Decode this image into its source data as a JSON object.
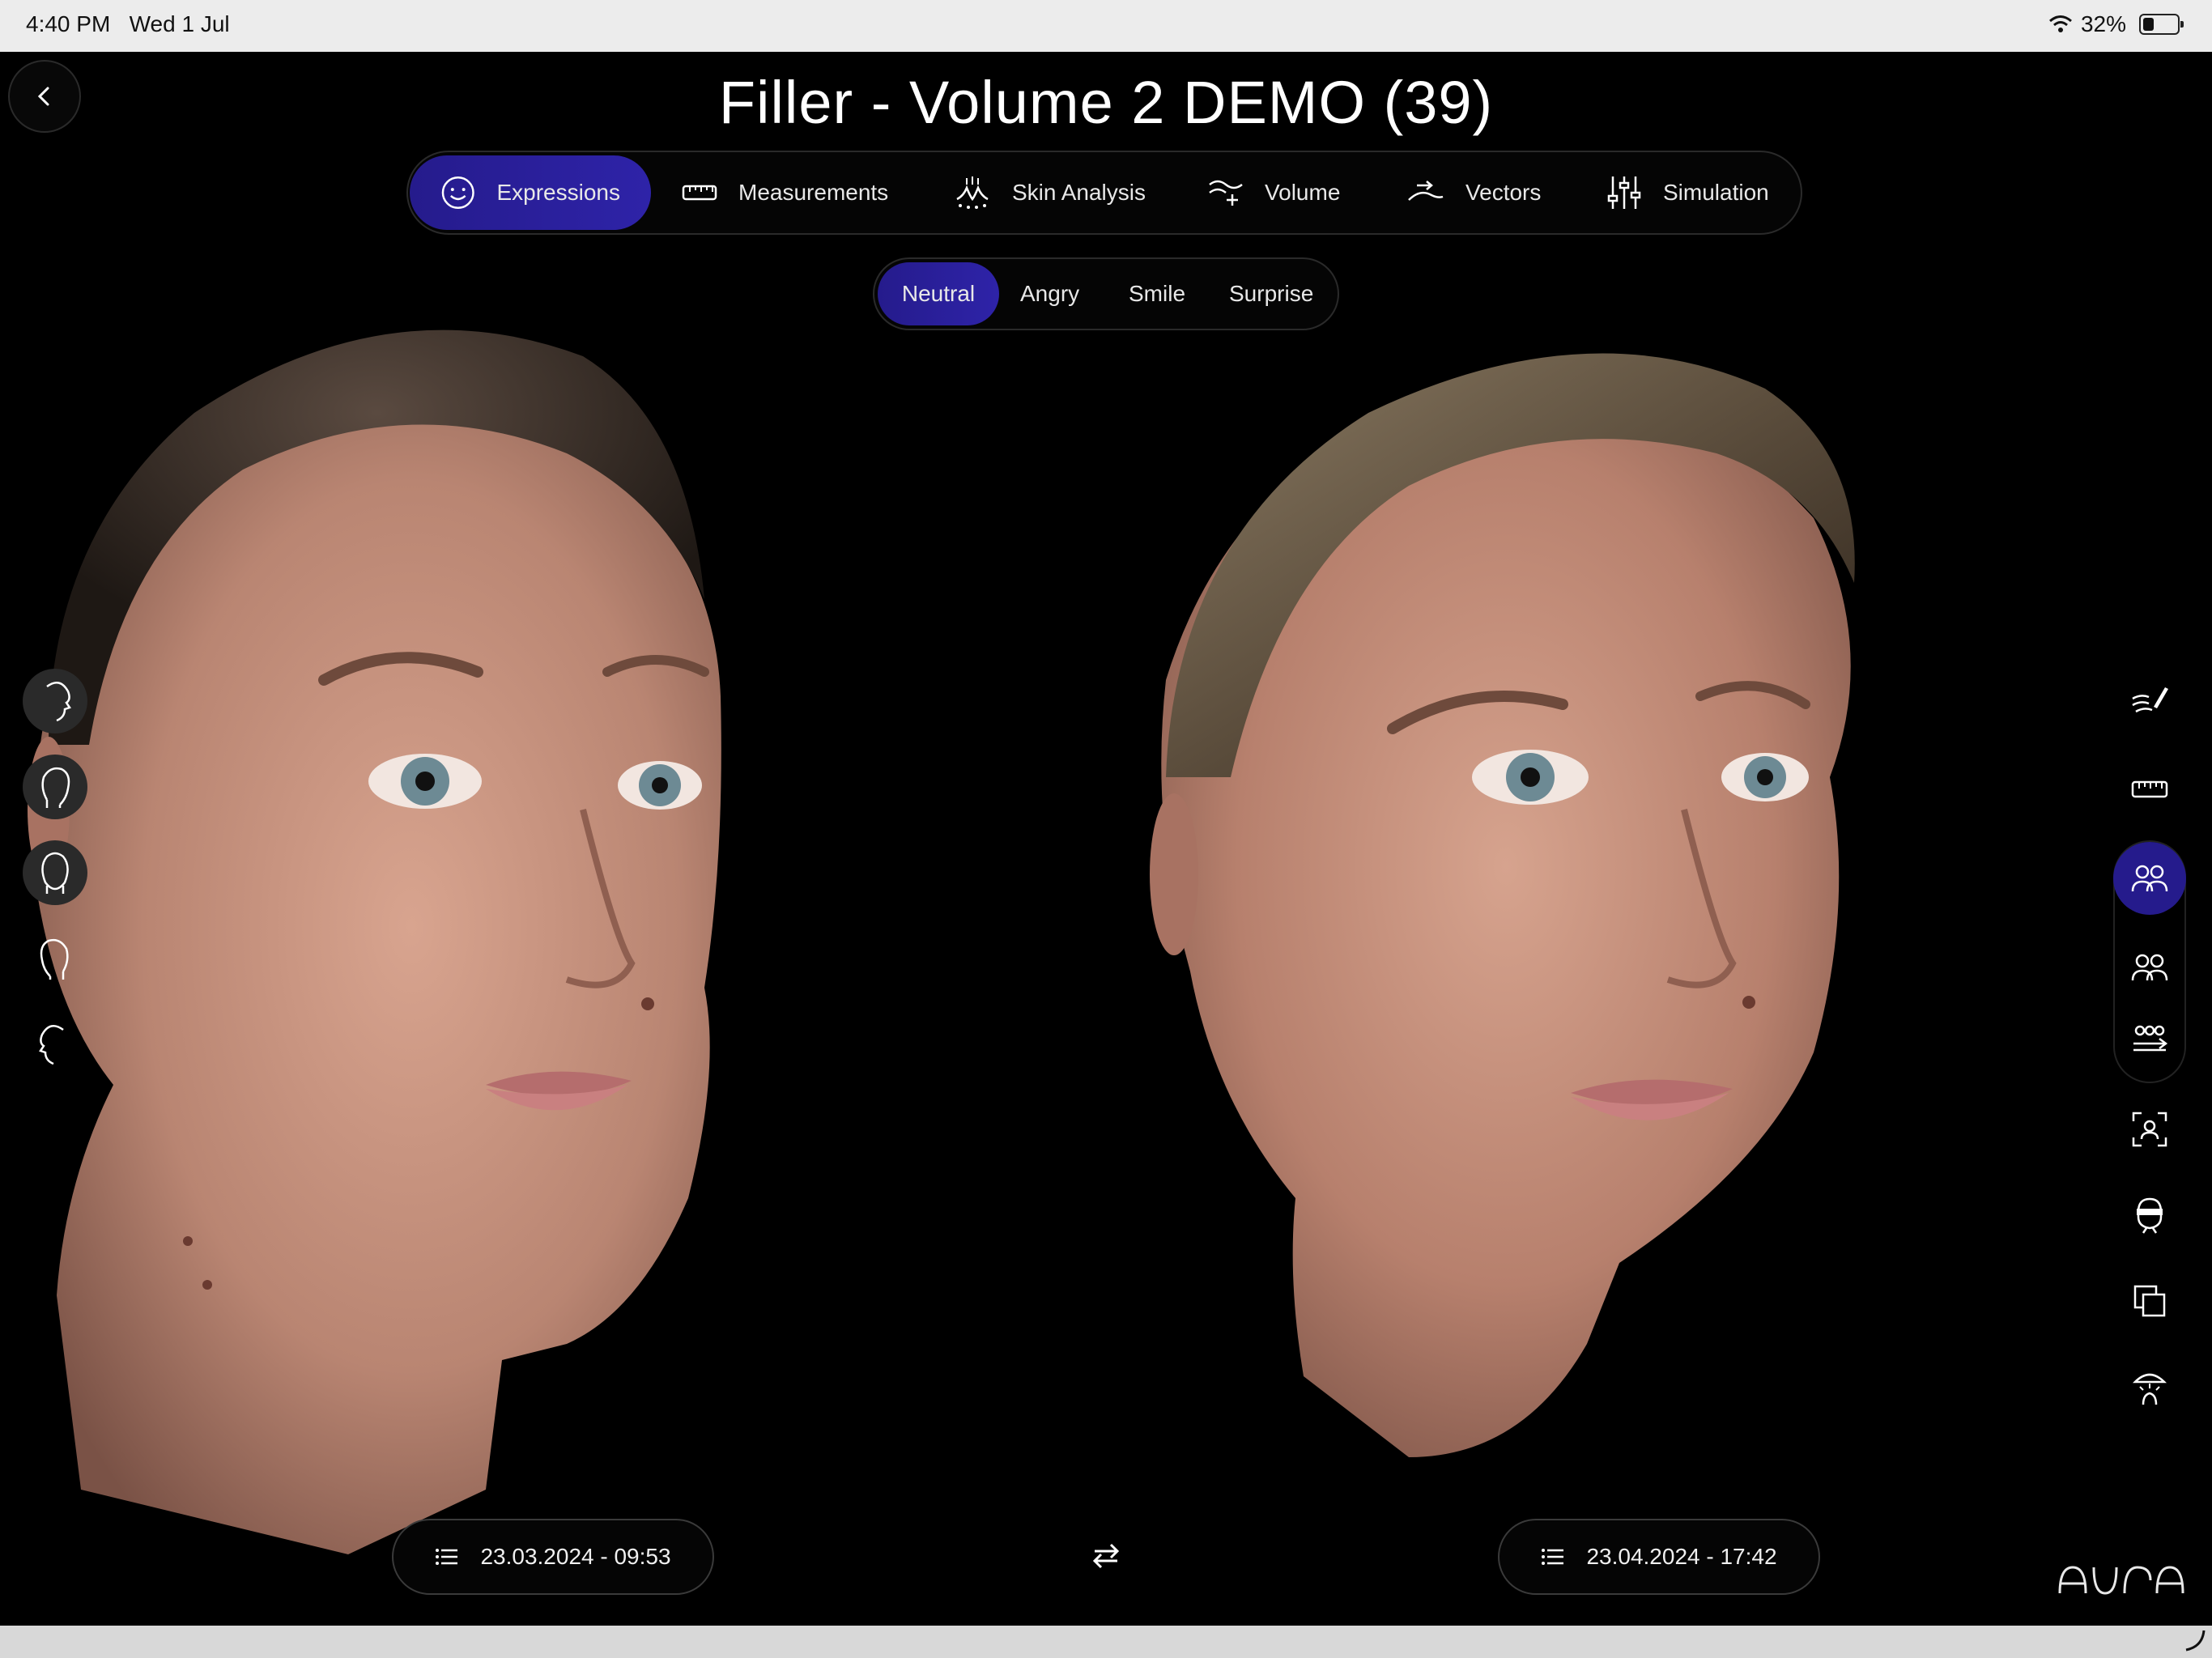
{
  "status_bar": {
    "time": "4:40 PM",
    "date": "Wed 1 Jul",
    "battery": "32%",
    "battery_level": 0.32
  },
  "header": {
    "title": "Filler - Volume 2 DEMO (39)"
  },
  "tabs": [
    {
      "label": "Expressions",
      "icon": "smile-icon",
      "active": true
    },
    {
      "label": "Measurements",
      "icon": "ruler-icon",
      "active": false
    },
    {
      "label": "Skin Analysis",
      "icon": "skin-icon",
      "active": false
    },
    {
      "label": "Volume",
      "icon": "volume-icon",
      "active": false
    },
    {
      "label": "Vectors",
      "icon": "vectors-icon",
      "active": false
    },
    {
      "label": "Simulation",
      "icon": "sliders-icon",
      "active": false
    }
  ],
  "expressions": [
    {
      "label": "Neutral",
      "active": true
    },
    {
      "label": "Angry",
      "active": false
    },
    {
      "label": "Smile",
      "active": false
    },
    {
      "label": "Surprise",
      "active": false
    }
  ],
  "scans": {
    "left": {
      "date": "23.03.2024 - 09:53"
    },
    "right": {
      "date": "23.04.2024 - 17:42"
    }
  },
  "view_angles": [
    "profile-left-icon",
    "three-quarter-left-icon",
    "front-icon",
    "three-quarter-right-icon",
    "profile-right-icon"
  ],
  "right_toolbar": [
    "annotate-icon",
    "ruler-icon",
    "compare-side-by-side-icon",
    "compare-overlay-icon",
    "compare-multi-icon",
    "focus-face-icon",
    "mask-icon",
    "duplicate-icon",
    "lighting-icon"
  ],
  "brand": {
    "logo": "AURA"
  },
  "colors": {
    "accent": "#2a1fa0",
    "background": "#000000"
  }
}
